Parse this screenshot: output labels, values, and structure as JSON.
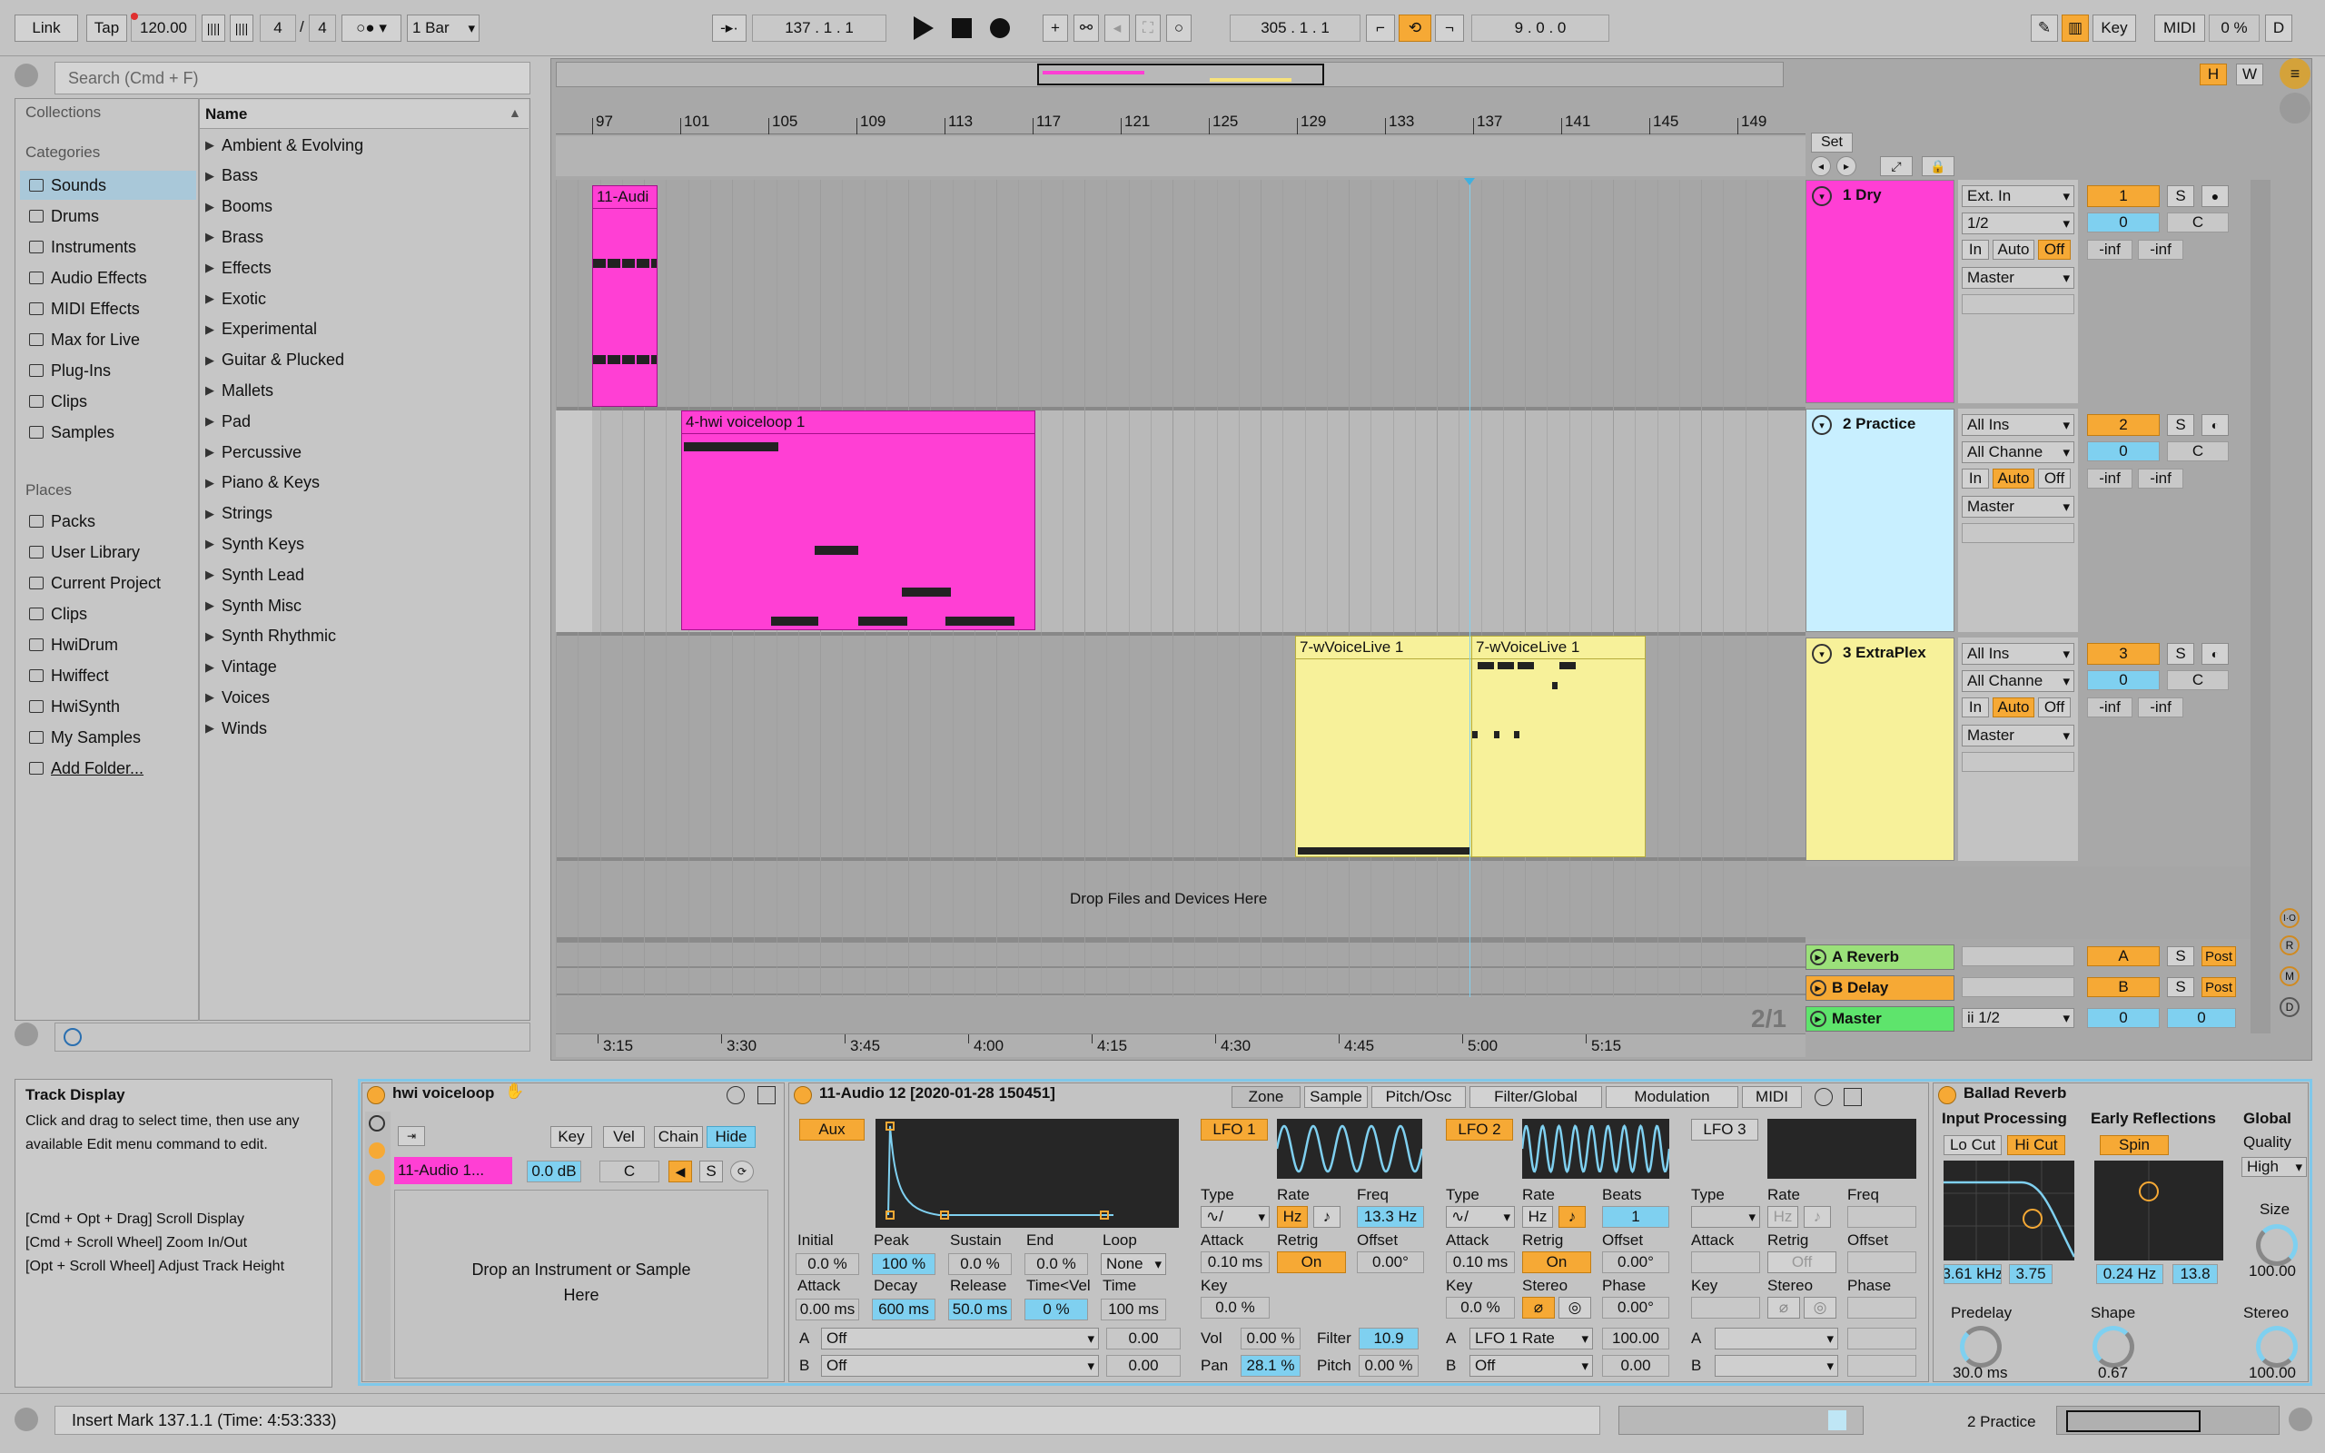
{
  "transport": {
    "link": "Link",
    "tap": "Tap",
    "tempo": "120.00",
    "sig_num": "4",
    "sig_den": "4",
    "quant": "1 Bar",
    "position": "137 .  1 .  1",
    "loop_start": "305 .  1 .  1",
    "loop_len": "9 .  0 .  0",
    "key": "Key",
    "midi": "MIDI",
    "cpu": "0 %",
    "d": "D"
  },
  "browser": {
    "search_placeholder": "Search (Cmd + F)",
    "collections": "Collections",
    "categories": "Categories",
    "places": "Places",
    "name_header": "Name",
    "category_items": [
      "Sounds",
      "Drums",
      "Instruments",
      "Audio Effects",
      "MIDI Effects",
      "Max for Live",
      "Plug-Ins",
      "Clips",
      "Samples"
    ],
    "place_items": [
      "Packs",
      "User Library",
      "Current Project",
      "Clips",
      "HwiDrum",
      "Hwiffect",
      "HwiSynth",
      "My Samples",
      "Add Folder..."
    ],
    "names": [
      "Ambient & Evolving",
      "Bass",
      "Booms",
      "Brass",
      "Effects",
      "Exotic",
      "Experimental",
      "Guitar & Plucked",
      "Mallets",
      "Pad",
      "Percussive",
      "Piano & Keys",
      "Strings",
      "Synth Keys",
      "Synth Lead",
      "Synth Misc",
      "Synth Rhythmic",
      "Vintage",
      "Voices",
      "Winds"
    ]
  },
  "ruler": {
    "bars": [
      "97",
      "101",
      "105",
      "109",
      "113",
      "117",
      "121",
      "125",
      "129",
      "133",
      "137",
      "141",
      "145",
      "149"
    ],
    "times": [
      "3:15",
      "3:30",
      "3:45",
      "4:00",
      "4:15",
      "4:30",
      "4:45",
      "5:00",
      "5:15"
    ],
    "set": "Set",
    "overview_h": "H",
    "overview_w": "W"
  },
  "tracks": [
    {
      "name": "1 Dry",
      "input": "Ext. In",
      "channel": "1/2",
      "output": "Master",
      "num": "1",
      "vol": "0",
      "pan": "C",
      "in": "In",
      "auto": "Auto",
      "off": "Off",
      "s": "S",
      "peak1": "-inf",
      "peak2": "-inf",
      "color": "#ff3fd4"
    },
    {
      "name": "2 Practice",
      "input": "All Ins",
      "channel": "All Channe",
      "output": "Master",
      "num": "2",
      "vol": "0",
      "pan": "C",
      "in": "In",
      "auto": "Auto",
      "off": "Off",
      "s": "S",
      "peak1": "-inf",
      "peak2": "-inf",
      "color": "#c8efff"
    },
    {
      "name": "3 ExtraPlex",
      "input": "All Ins",
      "channel": "All Channe",
      "output": "Master",
      "num": "3",
      "vol": "0",
      "pan": "C",
      "in": "In",
      "auto": "Auto",
      "off": "Off",
      "s": "S",
      "peak1": "-inf",
      "peak2": "-inf",
      "color": "#f7f19a"
    }
  ],
  "clips": {
    "c1": "11-Audi",
    "c2": "4-hwi voiceloop 1",
    "c3": "7-wVoiceLive 1",
    "c4": "7-wVoiceLive 1"
  },
  "drop_text": "Drop Files and Devices Here",
  "returns": [
    {
      "name": "A Reverb",
      "letter": "A",
      "s": "S",
      "post": "Post"
    },
    {
      "name": "B Delay",
      "letter": "B",
      "s": "S",
      "post": "Post"
    }
  ],
  "master": {
    "name": "Master",
    "channel": "ii 1/2",
    "vol1": "0",
    "vol2": "0"
  },
  "page_indicator": "2/1",
  "info": {
    "title": "Track Display",
    "body": "Click and drag to select time, then use any available Edit menu command to edit.",
    "h1": "[Cmd + Opt + Drag] Scroll Display",
    "h2": "[Cmd + Scroll Wheel] Zoom In/Out",
    "h3": "[Opt + Scroll Wheel] Adjust Track Height"
  },
  "rack": {
    "title": "hwi voiceloop",
    "key": "Key",
    "vel": "Vel",
    "chain": "Chain",
    "hide": "Hide",
    "chain_name": "11-Audio 1...",
    "chain_vol": "0.0 dB",
    "chain_pan": "C",
    "s": "S",
    "drop": "Drop an Instrument or Sample Here"
  },
  "sampler": {
    "title": "11-Audio 12 [2020-01-28 150451]",
    "tabs": [
      "Zone",
      "Sample",
      "Pitch/Osc",
      "Filter/Global",
      "Modulation",
      "MIDI"
    ],
    "aux": "Aux",
    "env_labels": [
      "Initial",
      "Peak",
      "Sustain",
      "End",
      "Loop"
    ],
    "env_values": [
      "0.0 %",
      "100 %",
      "0.0 %",
      "0.0 %",
      "None"
    ],
    "env2_labels": [
      "Attack",
      "Decay",
      "Release",
      "Time<Vel",
      "Time"
    ],
    "env2_values": [
      "0.00 ms",
      "600 ms",
      "50.0 ms",
      "0 %",
      "100 ms"
    ],
    "a": "A",
    "b": "B",
    "a_sel": "Off",
    "b_sel": "Off",
    "a_val": "0.00",
    "b_val": "0.00",
    "lfo1": {
      "name": "LFO 1",
      "type": "Type",
      "rate": "Rate",
      "freq": "Freq",
      "hz": "Hz",
      "freq_val": "13.3 Hz",
      "attack": "Attack",
      "retrig": "Retrig",
      "offset": "Offset",
      "attack_val": "0.10 ms",
      "retrig_val": "On",
      "offset_val": "0.00°",
      "key": "Key",
      "key_val": "0.0 %",
      "vol": "Vol",
      "vol_val": "0.00 %",
      "filter": "Filter",
      "filter_val": "10.9",
      "pan": "Pan",
      "pan_val": "28.1 %",
      "pitch": "Pitch",
      "pitch_val": "0.00 %"
    },
    "lfo2": {
      "name": "LFO 2",
      "type": "Type",
      "rate": "Rate",
      "beats": "Beats",
      "hz": "Hz",
      "beats_val": "1",
      "attack": "Attack",
      "retrig": "Retrig",
      "offset": "Offset",
      "attack_val": "0.10 ms",
      "retrig_val": "On",
      "offset_val": "0.00°",
      "key": "Key",
      "key_val": "0.0 %",
      "stereo": "Stereo",
      "phase": "Phase",
      "phase_val": "0.00°",
      "a_sel": "LFO 1 Rate",
      "a_val": "100.00",
      "b_sel": "Off",
      "b_val": "0.00"
    },
    "lfo3": {
      "name": "LFO 3",
      "type": "Type",
      "rate": "Rate",
      "freq": "Freq",
      "hz": "Hz",
      "attack": "Attack",
      "retrig": "Retrig",
      "offset": "Offset",
      "retrig_val": "Off",
      "key": "Key",
      "stereo": "Stereo",
      "phase": "Phase"
    }
  },
  "reverb": {
    "title": "Ballad Reverb",
    "input": "Input Processing",
    "early": "Early Reflections",
    "global": "Global",
    "quality": "Quality",
    "quality_val": "High",
    "locut": "Lo Cut",
    "hicut": "Hi Cut",
    "spin": "Spin",
    "freq": "3.61 kHz",
    "q": "3.75",
    "spin_freq": "0.24 Hz",
    "spin_amt": "13.8",
    "size": "Size",
    "size_val": "100.00",
    "predelay": "Predelay",
    "predelay_val": "30.0 ms",
    "shape": "Shape",
    "shape_val": "0.67",
    "stereo": "Stereo",
    "stereo_val": "100.00"
  },
  "status": {
    "text": "Insert Mark 137.1.1 (Time: 4:53:333)",
    "track": "2 Practice"
  }
}
